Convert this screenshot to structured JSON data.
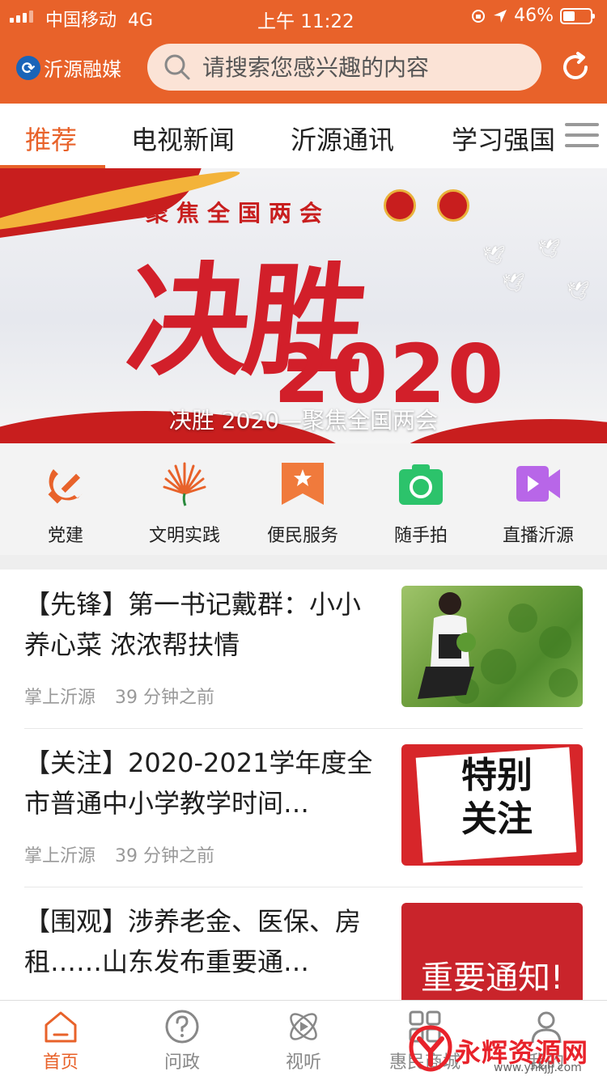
{
  "status_bar": {
    "carrier": "中国移动",
    "network": "4G",
    "time": "上午 11:22",
    "battery": "46%"
  },
  "header": {
    "logo_text": "沂源融媒",
    "search_placeholder": "请搜索您感兴趣的内容",
    "refresh_icon": "refresh-icon",
    "accent_color": "#e8622a"
  },
  "tabs": [
    {
      "label": "推荐",
      "active": true
    },
    {
      "label": "电视新闻",
      "active": false
    },
    {
      "label": "沂源通讯",
      "active": false
    },
    {
      "label": "学习强国",
      "active": false
    }
  ],
  "banner": {
    "focus_text": "聚焦全国两会",
    "headline": "决胜",
    "year": "2020",
    "caption": "决胜 2020—聚焦全国两会"
  },
  "quick_links": [
    {
      "label": "党建",
      "icon": "party-emblem-icon",
      "color": "#e8622a"
    },
    {
      "label": "文明实践",
      "icon": "fan-icon",
      "color": "#e8622a"
    },
    {
      "label": "便民服务",
      "icon": "bookmark-star-icon",
      "color": "#f07a3c"
    },
    {
      "label": "随手拍",
      "icon": "camera-icon",
      "color": "#2cc36b"
    },
    {
      "label": "直播沂源",
      "icon": "video-icon",
      "color": "#b866e8"
    }
  ],
  "articles": [
    {
      "title": "【先锋】第一书记戴群：小小养心菜 浓浓帮扶情",
      "source": "掌上沂源",
      "time": "39 分钟之前"
    },
    {
      "title": "【关注】2020-2021学年度全市普通中小学教学时间…",
      "source": "掌上沂源",
      "time": "39 分钟之前",
      "thumb_text": "特别\n关注"
    },
    {
      "title": "【围观】涉养老金、医保、房租……山东发布重要通…",
      "thumb_text": "重要通知!"
    }
  ],
  "bottom_nav": [
    {
      "label": "首页",
      "icon": "home-icon",
      "active": true
    },
    {
      "label": "问政",
      "icon": "question-icon",
      "active": false
    },
    {
      "label": "视听",
      "icon": "play-atom-icon",
      "active": false
    },
    {
      "label": "惠民商城",
      "icon": "grid-icon",
      "active": false
    },
    {
      "label": "我的",
      "icon": "user-icon",
      "active": false
    }
  ],
  "watermark": {
    "text": "永辉资源网",
    "url": "www.yhkjjj.com"
  }
}
